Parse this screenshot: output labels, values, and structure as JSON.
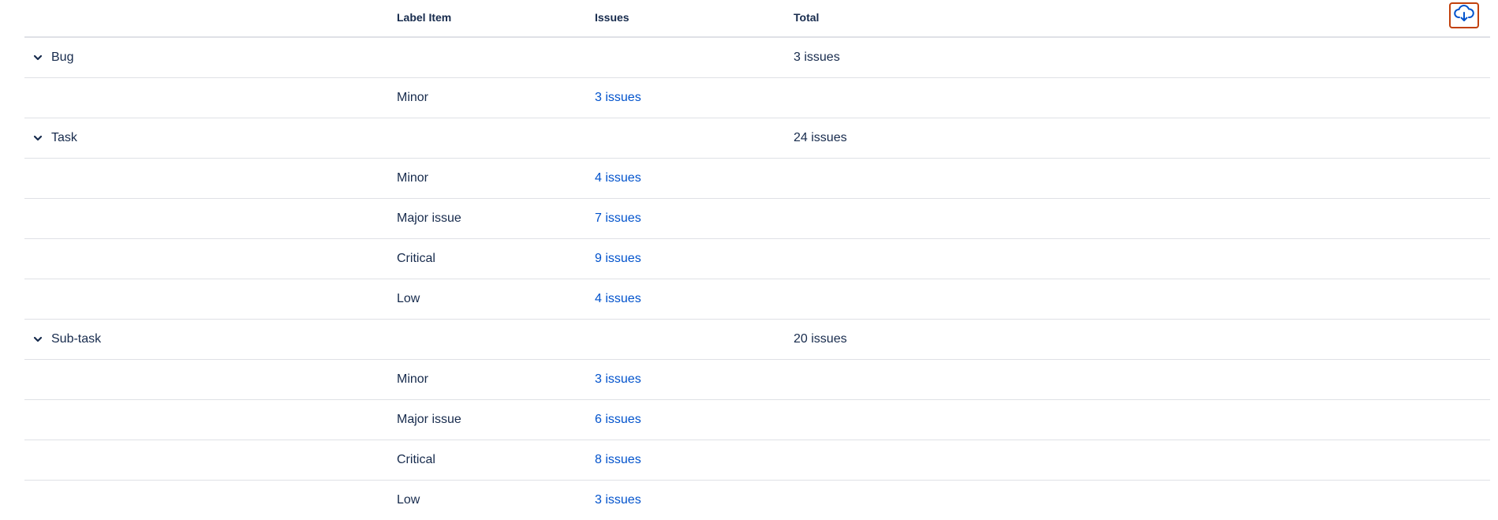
{
  "header": {
    "label_item": "Label Item",
    "issues": "Issues",
    "total": "Total"
  },
  "toolbar": {
    "download_icon": "cloud-download-icon"
  },
  "colors": {
    "link": "#0052cc",
    "accent_border": "#c2410c",
    "divider": "#dfe1e6"
  },
  "groups": [
    {
      "name": "Bug",
      "total": "3 issues",
      "items": [
        {
          "label": "Minor",
          "issues": "3 issues"
        }
      ]
    },
    {
      "name": "Task",
      "total": "24 issues",
      "items": [
        {
          "label": "Minor",
          "issues": "4 issues"
        },
        {
          "label": "Major issue",
          "issues": "7 issues"
        },
        {
          "label": "Critical",
          "issues": "9 issues"
        },
        {
          "label": "Low",
          "issues": "4 issues"
        }
      ]
    },
    {
      "name": "Sub-task",
      "total": "20 issues",
      "items": [
        {
          "label": "Minor",
          "issues": "3 issues"
        },
        {
          "label": "Major issue",
          "issues": "6 issues"
        },
        {
          "label": "Critical",
          "issues": "8 issues"
        },
        {
          "label": "Low",
          "issues": "3 issues"
        }
      ]
    }
  ]
}
